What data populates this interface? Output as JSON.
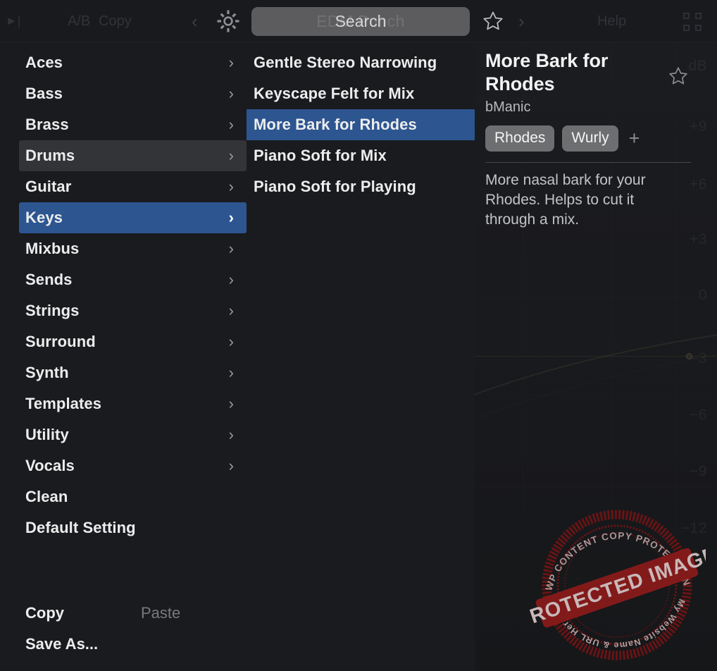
{
  "topbar": {
    "ab_label": "A/B",
    "copy_label": "Copy",
    "prev_arrow": "‹",
    "next_arrow": "›",
    "gear_icon": "gear-icon",
    "star_icon": "star-icon",
    "help_label": "Help",
    "expand_icon": "expand-icon",
    "search": {
      "label": "Search",
      "ghost_left": "EDM",
      "ghost_right": "Punch",
      "ghost_full": "EDM  Punch"
    }
  },
  "sidebar": {
    "categories": [
      {
        "label": "Aces",
        "chevron": "›",
        "state": "normal"
      },
      {
        "label": "Bass",
        "chevron": "›",
        "state": "normal"
      },
      {
        "label": "Brass",
        "chevron": "›",
        "state": "normal"
      },
      {
        "label": "Drums",
        "chevron": "›",
        "state": "hover"
      },
      {
        "label": "Guitar",
        "chevron": "›",
        "state": "normal"
      },
      {
        "label": "Keys",
        "chevron": "›",
        "state": "selected"
      },
      {
        "label": "Mixbus",
        "chevron": "›",
        "state": "normal"
      },
      {
        "label": "Sends",
        "chevron": "›",
        "state": "normal"
      },
      {
        "label": "Strings",
        "chevron": "›",
        "state": "normal"
      },
      {
        "label": "Surround",
        "chevron": "›",
        "state": "normal"
      },
      {
        "label": "Synth",
        "chevron": "›",
        "state": "normal"
      },
      {
        "label": "Templates",
        "chevron": "›",
        "state": "normal"
      },
      {
        "label": "Utility",
        "chevron": "›",
        "state": "normal"
      },
      {
        "label": "Vocals",
        "chevron": "›",
        "state": "normal"
      },
      {
        "label": "Clean",
        "chevron": "",
        "state": "normal"
      },
      {
        "label": "Default Setting",
        "chevron": "",
        "state": "normal"
      }
    ],
    "actions": {
      "copy_label": "Copy",
      "paste_label": "Paste",
      "save_as_label": "Save As..."
    }
  },
  "presets": {
    "items": [
      {
        "label": "Gentle Stereo Narrowing",
        "selected": false
      },
      {
        "label": "Keyscape Felt for Mix",
        "selected": false
      },
      {
        "label": "More Bark for Rhodes",
        "selected": true
      },
      {
        "label": "Piano Soft for Mix",
        "selected": false
      },
      {
        "label": "Piano Soft for Playing",
        "selected": false
      }
    ]
  },
  "detail": {
    "title": "More Bark for Rhodes",
    "author": "bManic",
    "tags": [
      "Rhodes",
      "Wurly"
    ],
    "add_tag_label": "+",
    "description": "More nasal bark for your Rhodes. Helps to cut it through a mix.",
    "favorite_icon": "star-outline-icon"
  },
  "background_scale": {
    "unit": "dB",
    "ticks": [
      "+9",
      "+6",
      "+3",
      "0",
      "−3",
      "−6",
      "−9",
      "−12"
    ]
  },
  "watermark": {
    "arc_top": "WP CONTENT COPY PROTECTION PLUGIN",
    "banner": "PROTECTED IMAGE",
    "arc_bottom": "My Website Name & URL Here",
    "color": "#8d1b1b"
  },
  "colors": {
    "accent_blue": "#2d5590",
    "hover_gray": "#333437",
    "panel_bg": "#1a1b1e",
    "topbar_bg": "#191a1d",
    "tag_bg": "#6d6e70"
  }
}
